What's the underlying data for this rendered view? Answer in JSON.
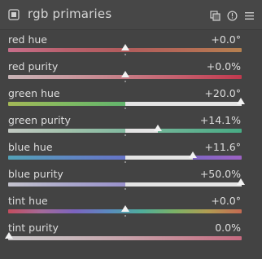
{
  "module": {
    "title": "rgb primaries",
    "icons": [
      "module-icon",
      "presets-icon",
      "reset-icon",
      "menu-icon"
    ]
  },
  "sliders": [
    {
      "label": "red hue",
      "value": "+0.0°",
      "level": 0.5,
      "bipolar": true,
      "gradient": [
        "#c76e8a",
        "#b9606c",
        "#b25c5c",
        "#b56a56",
        "#b5804f"
      ]
    },
    {
      "label": "red purity",
      "value": "+0.0%",
      "level": 0.5,
      "bipolar": true,
      "gradient": [
        "#c8b4b6",
        "#c89aa0",
        "#c67c85",
        "#c55c6b",
        "#c0394e"
      ]
    },
    {
      "label": "green hue",
      "value": "+20.0°",
      "level": 1.0,
      "bipolar": true,
      "gradient": [
        "#a3b857",
        "#7fba62",
        "#63b56d",
        "#5aa97a",
        "#5a9b85"
      ]
    },
    {
      "label": "green purity",
      "value": "+14.1%",
      "level": 0.64,
      "bipolar": true,
      "gradient": [
        "#c2c8c2",
        "#a2c2ac",
        "#82baa0",
        "#65b292",
        "#47ab84"
      ]
    },
    {
      "label": "blue hue",
      "value": "+11.6°",
      "level": 0.79,
      "bipolar": true,
      "gradient": [
        "#53a1b7",
        "#5e88c2",
        "#6674c7",
        "#7a67c6",
        "#9c62c3"
      ]
    },
    {
      "label": "blue purity",
      "value": "+50.0%",
      "level": 1.0,
      "bipolar": true,
      "gradient": [
        "#c3c2cc",
        "#aba8cc",
        "#9a92cc",
        "#8d80cb",
        "#7f6fca"
      ]
    },
    {
      "label": "tint hue",
      "value": "+0.0°",
      "level": 0.5,
      "bipolar": true,
      "gradient": [
        "#c44d5e",
        "#a46a9a",
        "#7c64c0",
        "#5a8ac0",
        "#4fae9c",
        "#7cb266",
        "#b29c52",
        "#c46a52"
      ]
    },
    {
      "label": "tint purity",
      "value": "0.0%",
      "level": 0.0,
      "bipolar": false,
      "gradient": [
        "#c9c6c8",
        "#c8b8bc",
        "#c8a2aa",
        "#c78795",
        "#c66a80"
      ]
    }
  ],
  "colors": {
    "background": "#434343",
    "header": "#474747",
    "fill": "#e4e4e4",
    "marker": "#f2f2f2"
  }
}
